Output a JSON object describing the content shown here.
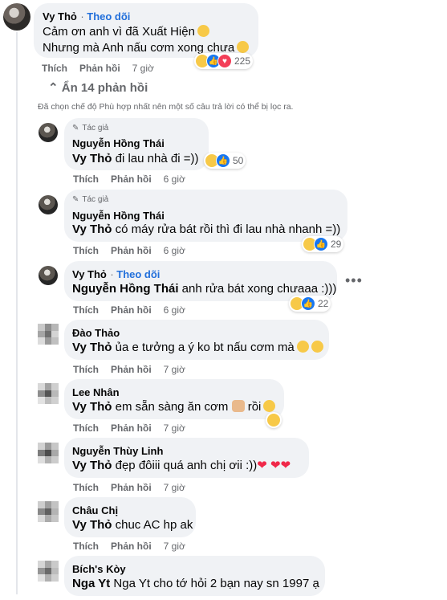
{
  "top": {
    "name": "Vy Thỏ",
    "follow": "Theo dõi",
    "line1": "Cảm ơn anh vì đã Xuất Hiện",
    "line2": "Nhưng mà Anh nấu cơm xong chưa",
    "reaction_count": "225",
    "actions": {
      "like": "Thích",
      "reply": "Phản hồi",
      "time": "7 giờ"
    }
  },
  "hide_replies": "Ẩn 14 phản hồi",
  "filter_notice": "Đã chọn chế độ Phù hợp nhất nên một số câu trả lời có thể bị lọc ra.",
  "replies": [
    {
      "author_badge": "Tác giả",
      "name": "Nguyễn Hồng Thái",
      "mention": "Vy Thỏ",
      "text": "đi lau nhà đi =))",
      "reaction_count": "50",
      "time": "6 giờ"
    },
    {
      "author_badge": "Tác giả",
      "name": "Nguyễn Hồng Thái",
      "mention": "Vy Thỏ",
      "text": "có máy rửa bát rồi thì đi lau nhà nhanh =))",
      "reaction_count": "29",
      "time": "6 giờ"
    },
    {
      "name": "Vy Thỏ",
      "follow": "Theo dõi",
      "mention": "Nguyễn Hồng Thái",
      "text": "anh rửa bát xong chưaaa :)))",
      "reaction_count": "22",
      "time": "6 giờ"
    },
    {
      "name": "Đào Thảo",
      "mention": "Vy Thỏ",
      "text": "ủa e tưởng a ý ko bt nấu cơm mà",
      "time": "7 giờ"
    },
    {
      "name": "Lee Nhân",
      "mention": "Vy Thỏ",
      "text": "em sẵn sàng ăn cơm",
      "text2": "rồi",
      "time": "7 giờ"
    },
    {
      "name": "Nguyễn Thùy Linh",
      "mention": "Vy Thỏ",
      "text": "đẹp đôiii quá anh chị ơii :))",
      "time": "7 giờ"
    },
    {
      "name": "Châu Chị",
      "mention": "Vy Thỏ",
      "text": "chuc AC hp ak",
      "time": "7 giờ"
    },
    {
      "name": "Bích's Kòy",
      "mention": "Nga Yt",
      "text": "Nga Yt cho tớ hỏi 2 bạn nay sn 1997 ạ"
    }
  ],
  "actions": {
    "like": "Thích",
    "reply": "Phản hồi"
  },
  "icons": [
    "avatar",
    "haha-reaction",
    "like-reaction",
    "love-reaction",
    "pencil-icon",
    "more-options-icon",
    "arrow-up-icon"
  ]
}
